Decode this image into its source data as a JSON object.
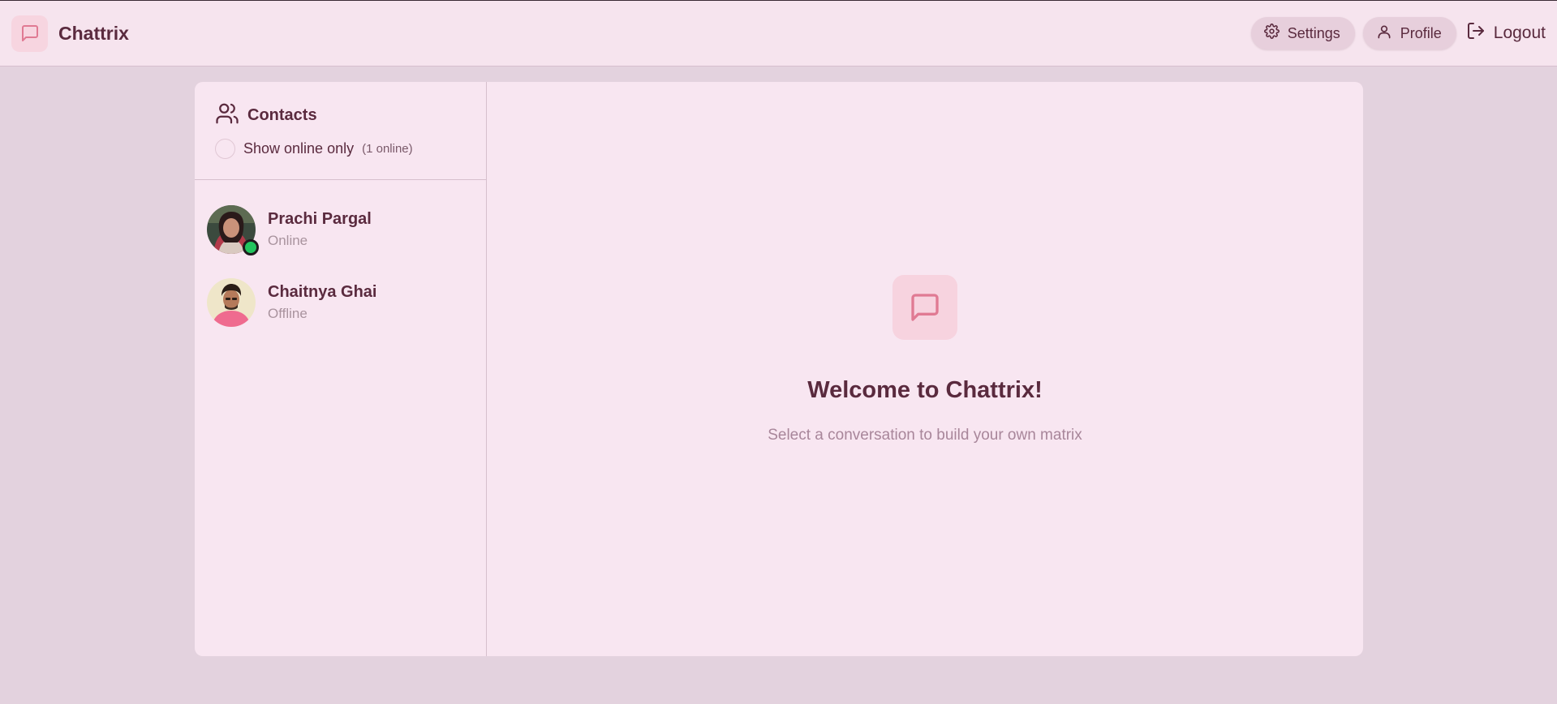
{
  "app": {
    "title": "Chattrix",
    "logo_icon": "message-square-icon"
  },
  "header": {
    "settings_label": "Settings",
    "profile_label": "Profile",
    "logout_label": "Logout"
  },
  "sidebar": {
    "title": "Contacts",
    "filter_label": "Show online only",
    "online_count": "(1 online)",
    "filter_checked": false,
    "contacts": [
      {
        "name": "Prachi Pargal",
        "status": "Online",
        "online": true
      },
      {
        "name": "Chaitnya Ghai",
        "status": "Offline",
        "online": false
      }
    ]
  },
  "main": {
    "welcome_title": "Welcome to Chattrix!",
    "welcome_subtitle": "Select a conversation to build your own matrix"
  },
  "colors": {
    "page_bg": "#e3d2de",
    "panel_bg": "#f8e6f1",
    "header_bg": "#f6e4ee",
    "text_primary": "#5a2a3e",
    "text_muted": "#a9939e",
    "accent": "#e07a93",
    "online": "#22c55e"
  }
}
